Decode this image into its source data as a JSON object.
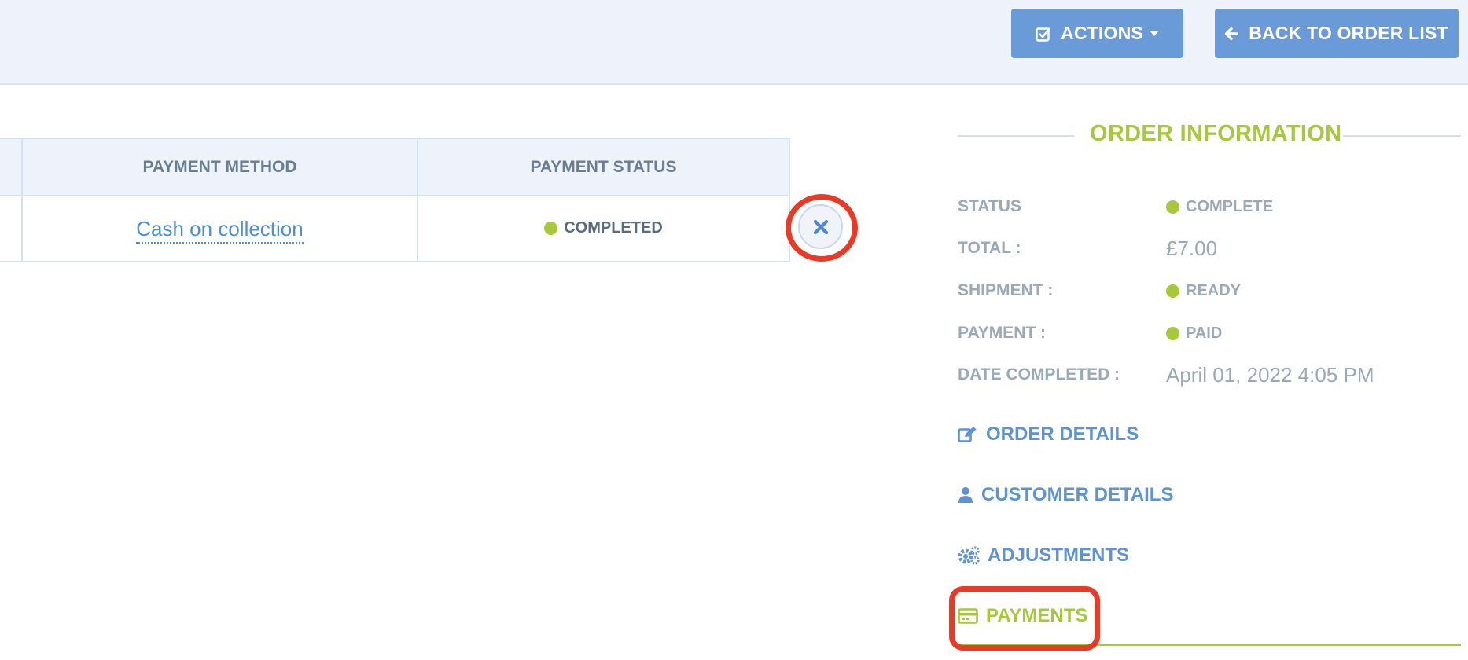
{
  "toolbar": {
    "actions_label": "ACTIONS",
    "back_label": "BACK TO ORDER LIST"
  },
  "payments_table": {
    "columns": [
      "PAYMENT METHOD",
      "PAYMENT STATUS"
    ],
    "rows": [
      {
        "method": "Cash on collection",
        "status": "COMPLETED"
      }
    ]
  },
  "order_info": {
    "title": "ORDER INFORMATION",
    "status_label": "STATUS",
    "status_value": "COMPLETE",
    "total_label": "TOTAL :",
    "total_value": "£7.00",
    "shipment_label": "SHIPMENT :",
    "shipment_value": "READY",
    "payment_label": "PAYMENT :",
    "payment_value": "PAID",
    "date_label": "DATE COMPLETED :",
    "date_value": "April 01, 2022 4:05 PM"
  },
  "side_nav": {
    "items": [
      {
        "label": "ORDER DETAILS",
        "icon": "edit-icon"
      },
      {
        "label": "CUSTOMER DETAILS",
        "icon": "user-icon"
      },
      {
        "label": "ADJUSTMENTS",
        "icon": "gears-icon"
      },
      {
        "label": "PAYMENTS",
        "icon": "credit-card-icon",
        "active": true
      }
    ]
  },
  "colors": {
    "accent_green": "#a6c93c",
    "primary_blue": "#6b9ad8",
    "link_blue": "#5b93d5",
    "highlight_red": "#e93a26"
  }
}
